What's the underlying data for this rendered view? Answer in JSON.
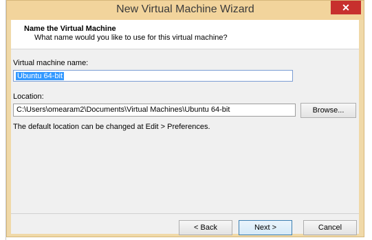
{
  "window": {
    "title": "New Virtual Machine Wizard",
    "close_glyph": "✕"
  },
  "header": {
    "title": "Name the Virtual Machine",
    "subtitle": "What name would you like to use for this virtual machine?"
  },
  "vm_name": {
    "label": "Virtual machine name:",
    "value": "Ubuntu 64-bit"
  },
  "location": {
    "label": "Location:",
    "value": "C:\\Users\\omearam2\\Documents\\Virtual Machines\\Ubuntu 64-bit",
    "browse_label": "Browse...",
    "note": "The default location can be changed at Edit > Preferences."
  },
  "buttons": {
    "back": "< Back",
    "next": "Next >",
    "cancel": "Cancel"
  },
  "colors": {
    "titlebar": "#f2d49c",
    "close": "#c7302d",
    "selection": "#3399ff"
  }
}
